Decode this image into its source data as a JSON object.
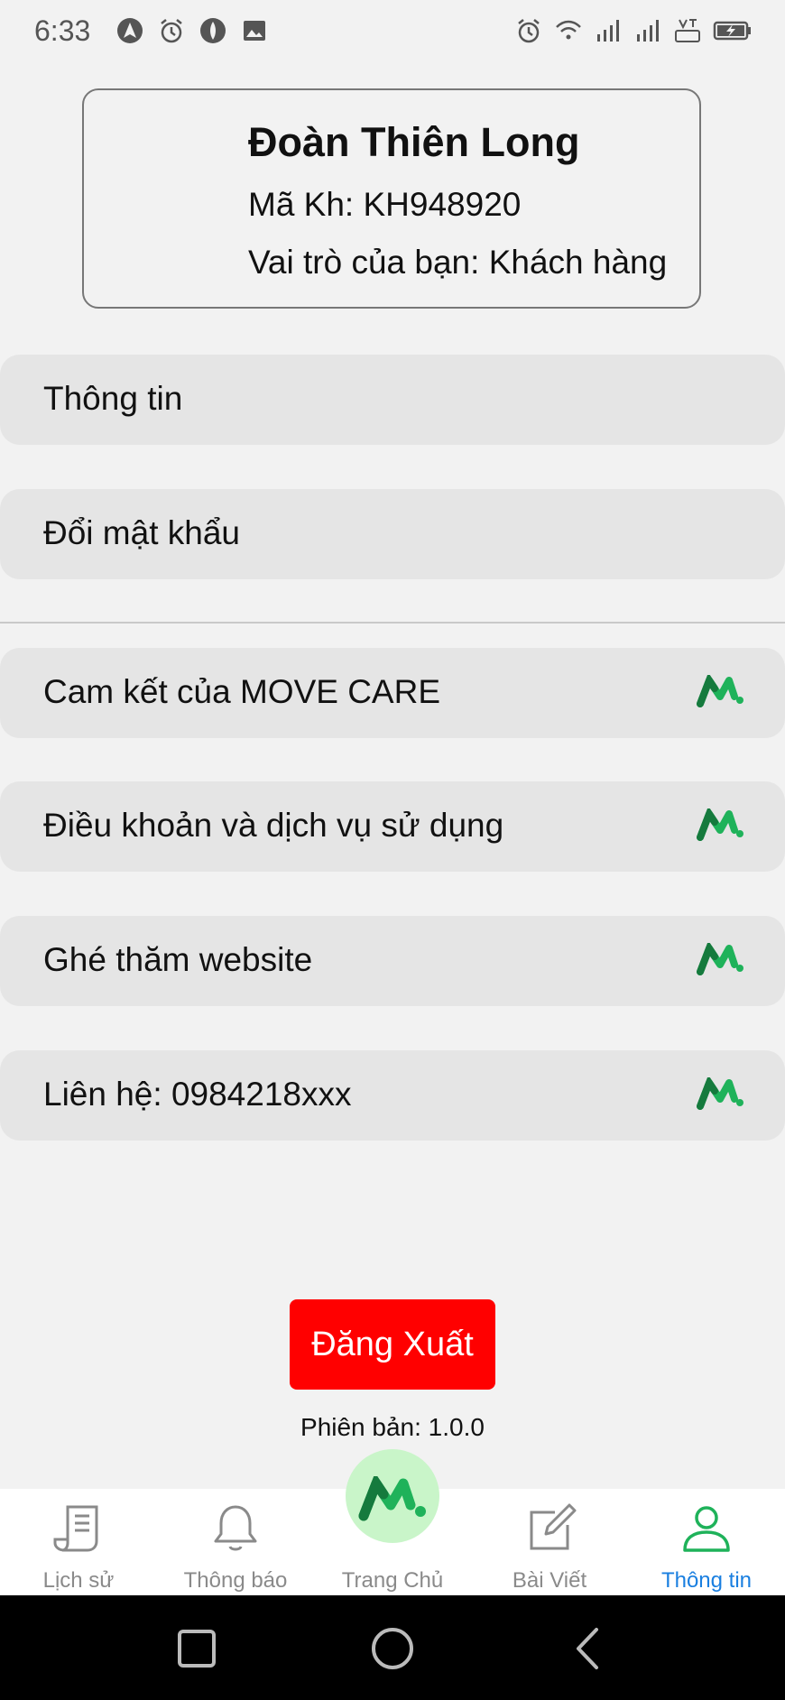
{
  "status_bar": {
    "time": "6:33",
    "left_icons": [
      "navigation-icon",
      "alarm-icon",
      "vpn-icon",
      "image-icon"
    ],
    "right_icons": [
      "alarm-icon",
      "wifi-icon",
      "signal-icon",
      "signal-icon",
      "volte-icon",
      "battery-charging-icon"
    ]
  },
  "profile": {
    "name": "Đoàn Thiên Long",
    "code": "Mã Kh: KH948920",
    "role": "Vai trò của bạn: Khách hàng"
  },
  "menu": {
    "info": "Thông tin",
    "change_password": "Đổi mật khẩu",
    "commitment": "Cam kết của MOVE CARE",
    "terms": "Điều khoản và dịch vụ sử dụng",
    "website": "Ghé thăm website",
    "contact": "Liên hệ: 0984218xxx"
  },
  "logout_label": "Đăng Xuất",
  "version": "Phiên bản: 1.0.0",
  "bottom_nav": {
    "history": "Lịch sử",
    "notifications": "Thông báo",
    "home": "Trang Chủ",
    "posts": "Bài Viết",
    "info": "Thông tin",
    "active": "info"
  },
  "colors": {
    "accent": "#1a7fe0",
    "logout": "#ff0000",
    "brand_green": "#1fb25a",
    "brand_dark_green": "#157a3d"
  }
}
